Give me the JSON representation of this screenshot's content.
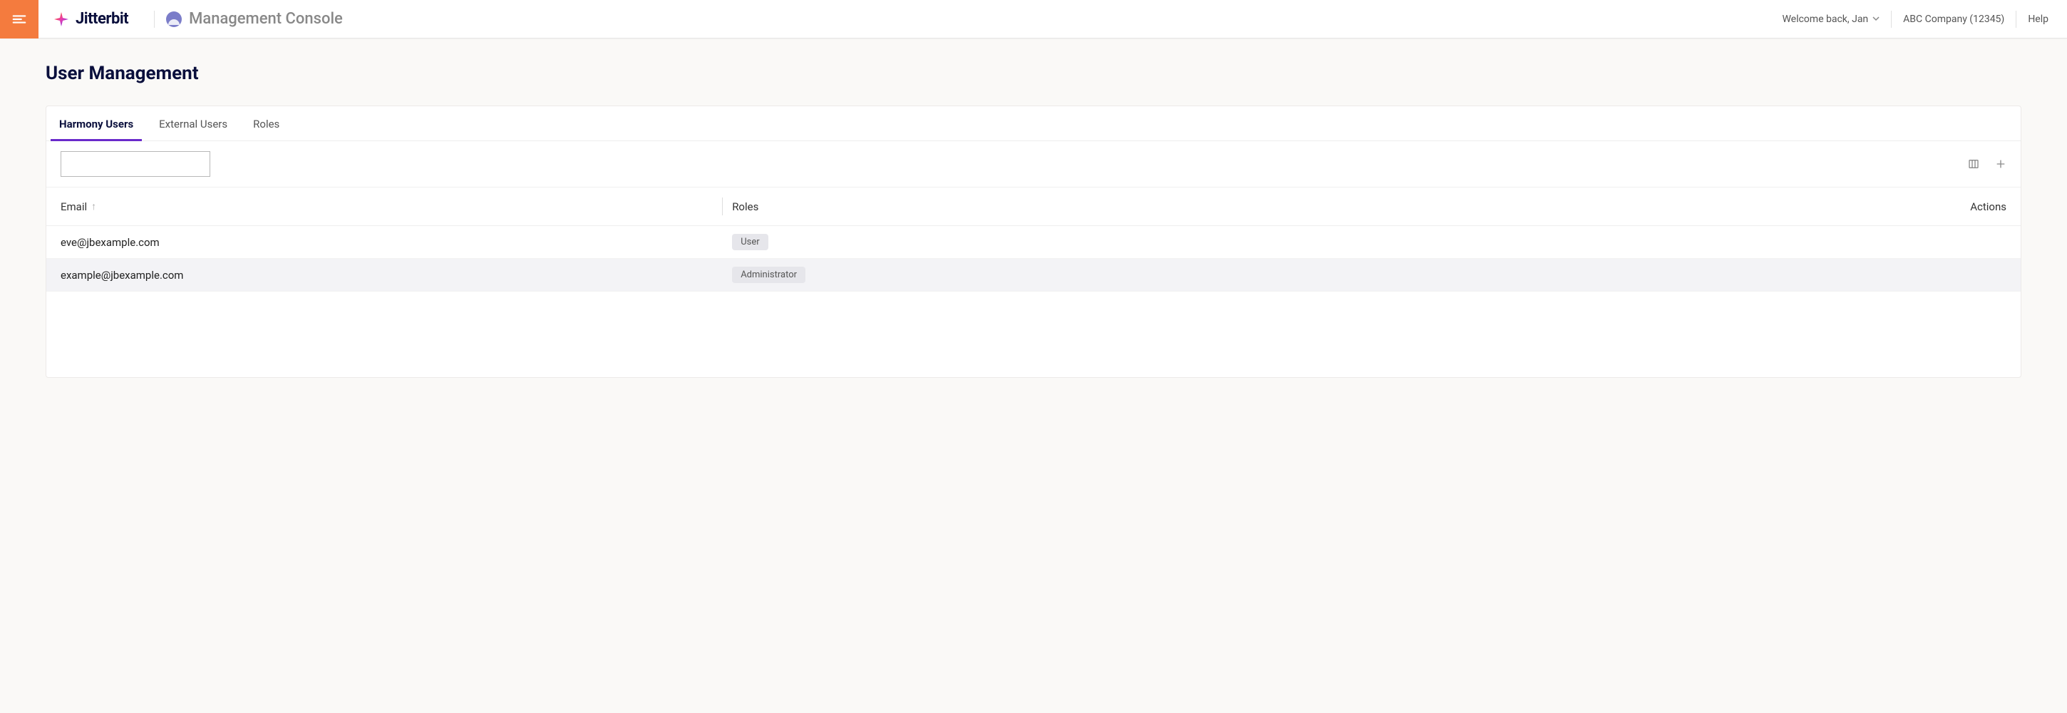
{
  "header": {
    "brand_text": "Jitterbit",
    "console_title": "Management Console",
    "welcome_text": "Welcome back, Jan",
    "org_text": "ABC Company (12345)",
    "help_text": "Help"
  },
  "page": {
    "title": "User Management"
  },
  "tabs": [
    {
      "label": "Harmony Users",
      "active": true
    },
    {
      "label": "External Users",
      "active": false
    },
    {
      "label": "Roles",
      "active": false
    }
  ],
  "search": {
    "placeholder": ""
  },
  "table": {
    "columns": {
      "email": "Email",
      "roles": "Roles",
      "actions": "Actions"
    },
    "rows": [
      {
        "email": "eve@jbexample.com",
        "role": "User"
      },
      {
        "email": "example@jbexample.com",
        "role": "Administrator"
      }
    ]
  }
}
